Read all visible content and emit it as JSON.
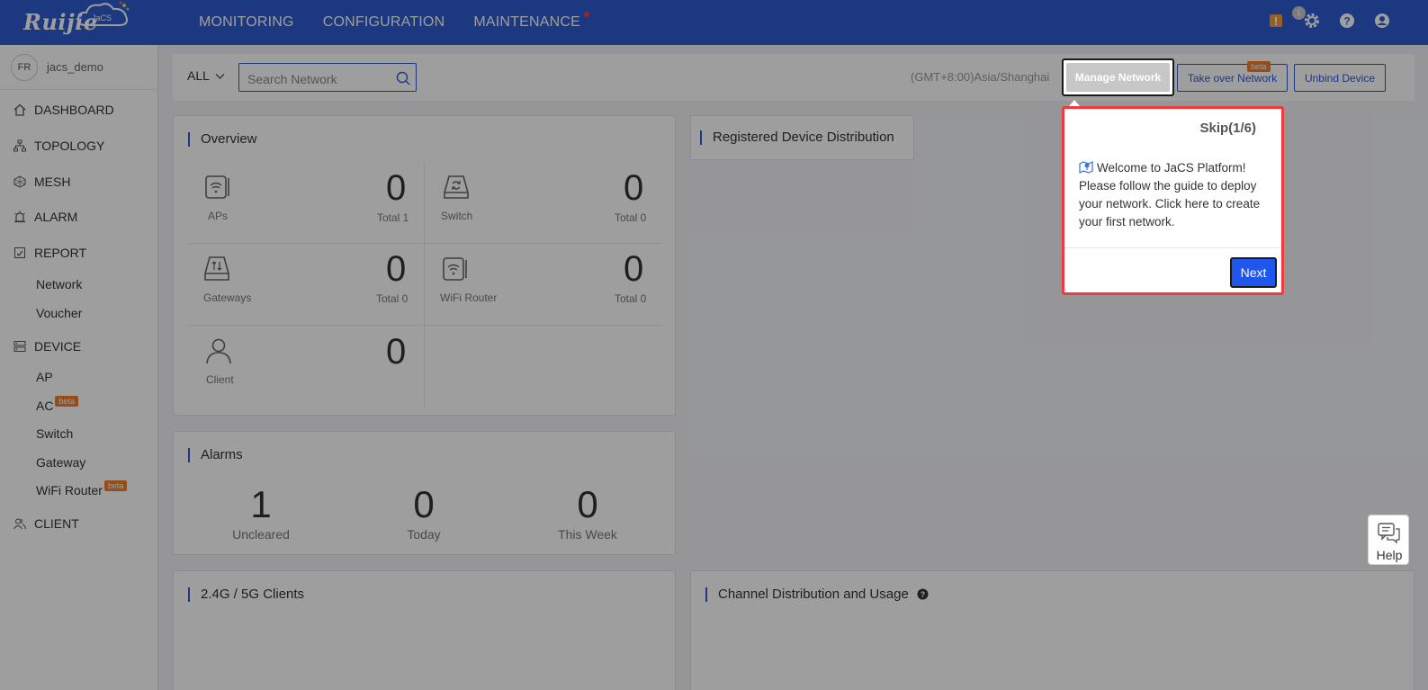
{
  "header": {
    "logo_text": "Ruijie",
    "logo_badge": "JaCS",
    "nav": [
      "MONITORING",
      "CONFIGURATION",
      "MAINTENANCE"
    ],
    "notification_count": "1"
  },
  "sidebar": {
    "username": "jacs_demo",
    "avatar_text": "FR",
    "menu": {
      "dashboard": "DASHBOARD",
      "topology": "TOPOLOGY",
      "mesh": "MESH",
      "alarm": "ALARM",
      "report": "REPORT",
      "report_network": "Network",
      "report_voucher": "Voucher",
      "device": "DEVICE",
      "device_ap": "AP",
      "device_ac": "AC",
      "device_switch": "Switch",
      "device_gateway": "Gateway",
      "device_wifi_router": "WiFi Router",
      "client": "CLIENT"
    },
    "beta": "beta"
  },
  "toolbar": {
    "scope": "ALL",
    "search_placeholder": "Search Network",
    "timezone": "(GMT+8:00)Asia/Shanghai",
    "manage_network": "Manage Network",
    "take_over_network": "Take over Network",
    "take_over_beta": "beta",
    "unbind_device": "Unbind Device"
  },
  "overview": {
    "title": "Overview",
    "items": [
      {
        "label": "APs",
        "count": "0",
        "total": "Total 1"
      },
      {
        "label": "Switch",
        "count": "0",
        "total": "Total 0"
      },
      {
        "label": "Gateways",
        "count": "0",
        "total": "Total 0"
      },
      {
        "label": "WiFi Router",
        "count": "0",
        "total": "Total 0"
      },
      {
        "label": "Client",
        "count": "0"
      }
    ]
  },
  "registered": {
    "title": "Registered Device Distribution"
  },
  "alarms": {
    "title": "Alarms",
    "items": [
      {
        "value": "1",
        "label": "Uncleared"
      },
      {
        "value": "0",
        "label": "Today"
      },
      {
        "value": "0",
        "label": "This Week"
      }
    ]
  },
  "clients": {
    "title": "2.4G / 5G Clients"
  },
  "channel": {
    "title": "Channel Distribution and Usage"
  },
  "guide": {
    "skip": "Skip(1/6)",
    "message": "Welcome to JaCS Platform! Please follow the guide to deploy your network. Click here to create your first network.",
    "next": "Next"
  },
  "help": {
    "label": "Help"
  },
  "colors": {
    "brand": "#2e5bd1",
    "accent_beta": "#f07f2a",
    "popover_border": "#ef3b3b",
    "next_button": "#1f56ee"
  }
}
